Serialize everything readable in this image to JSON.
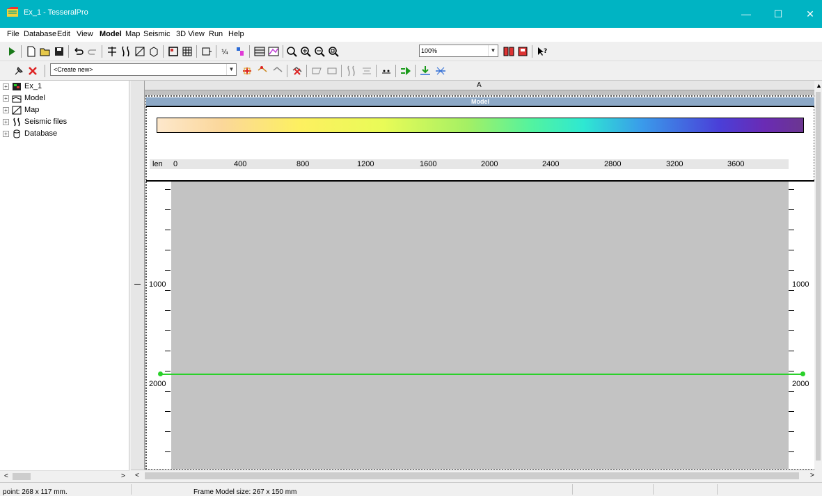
{
  "window": {
    "title": "Ex_1 - TesseralPro",
    "minimize": "—",
    "maximize": "☐",
    "close": "✕"
  },
  "menu": [
    "File",
    "Database",
    "Edit",
    "View",
    "Model",
    "Map",
    "Seismic",
    "3D View",
    "Run",
    "Help"
  ],
  "toolbar": {
    "zoom_value": "100%",
    "create_new": "<Create new>"
  },
  "tree": {
    "items": [
      {
        "label": "Ex_1",
        "icon": "project-icon"
      },
      {
        "label": "Model",
        "icon": "model-icon"
      },
      {
        "label": "Map",
        "icon": "map-icon"
      },
      {
        "label": "Seismic files",
        "icon": "seismic-icon"
      },
      {
        "label": "Database",
        "icon": "database-icon"
      }
    ]
  },
  "sheet": {
    "column_header": "A",
    "model_title": "Model"
  },
  "colorbar": {
    "axis_label": "len",
    "ticks": [
      "0",
      "400",
      "800",
      "1200",
      "1600",
      "2000",
      "2400",
      "2800",
      "3200",
      "3600"
    ],
    "gradient": [
      "#fde8cc",
      "#fdf060",
      "#a4f064",
      "#2ee8d2",
      "#4a3fd8",
      "#6b3690"
    ]
  },
  "depth": {
    "labels": [
      "1000",
      "2000"
    ]
  },
  "horizon_color": "#2ad12a",
  "status": {
    "point": "point: 268 x 117 mm.",
    "frame": "Frame Model size: 267 x 150 mm"
  }
}
